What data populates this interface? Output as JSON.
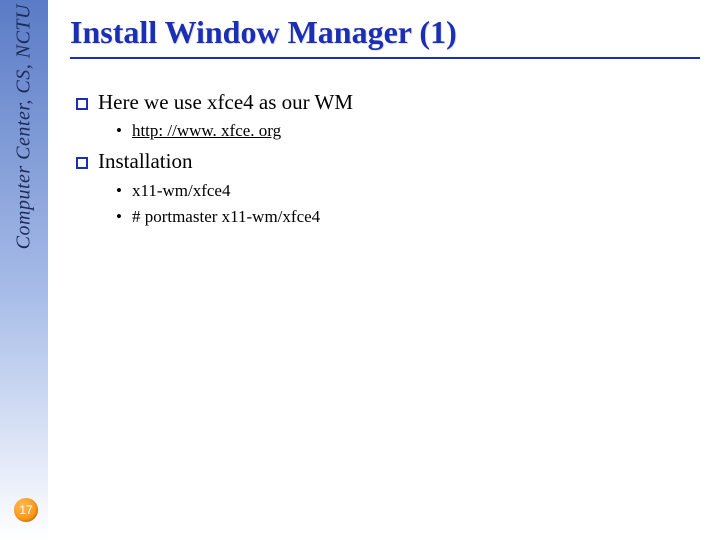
{
  "sidebar": {
    "label": "Computer Center, CS, NCTU"
  },
  "page_number": "17",
  "title": "Install Window Manager (1)",
  "bullets": {
    "b1": {
      "text": "Here we use xfce4 as  our WM"
    },
    "b1_1": {
      "link_text": "http: //www. xfce. org"
    },
    "b2": {
      "text": "Installation"
    },
    "b2_1": {
      "text": "x11-wm/xfce4"
    },
    "b2_2": {
      "text": "# portmaster  x11-wm/xfce4"
    }
  }
}
